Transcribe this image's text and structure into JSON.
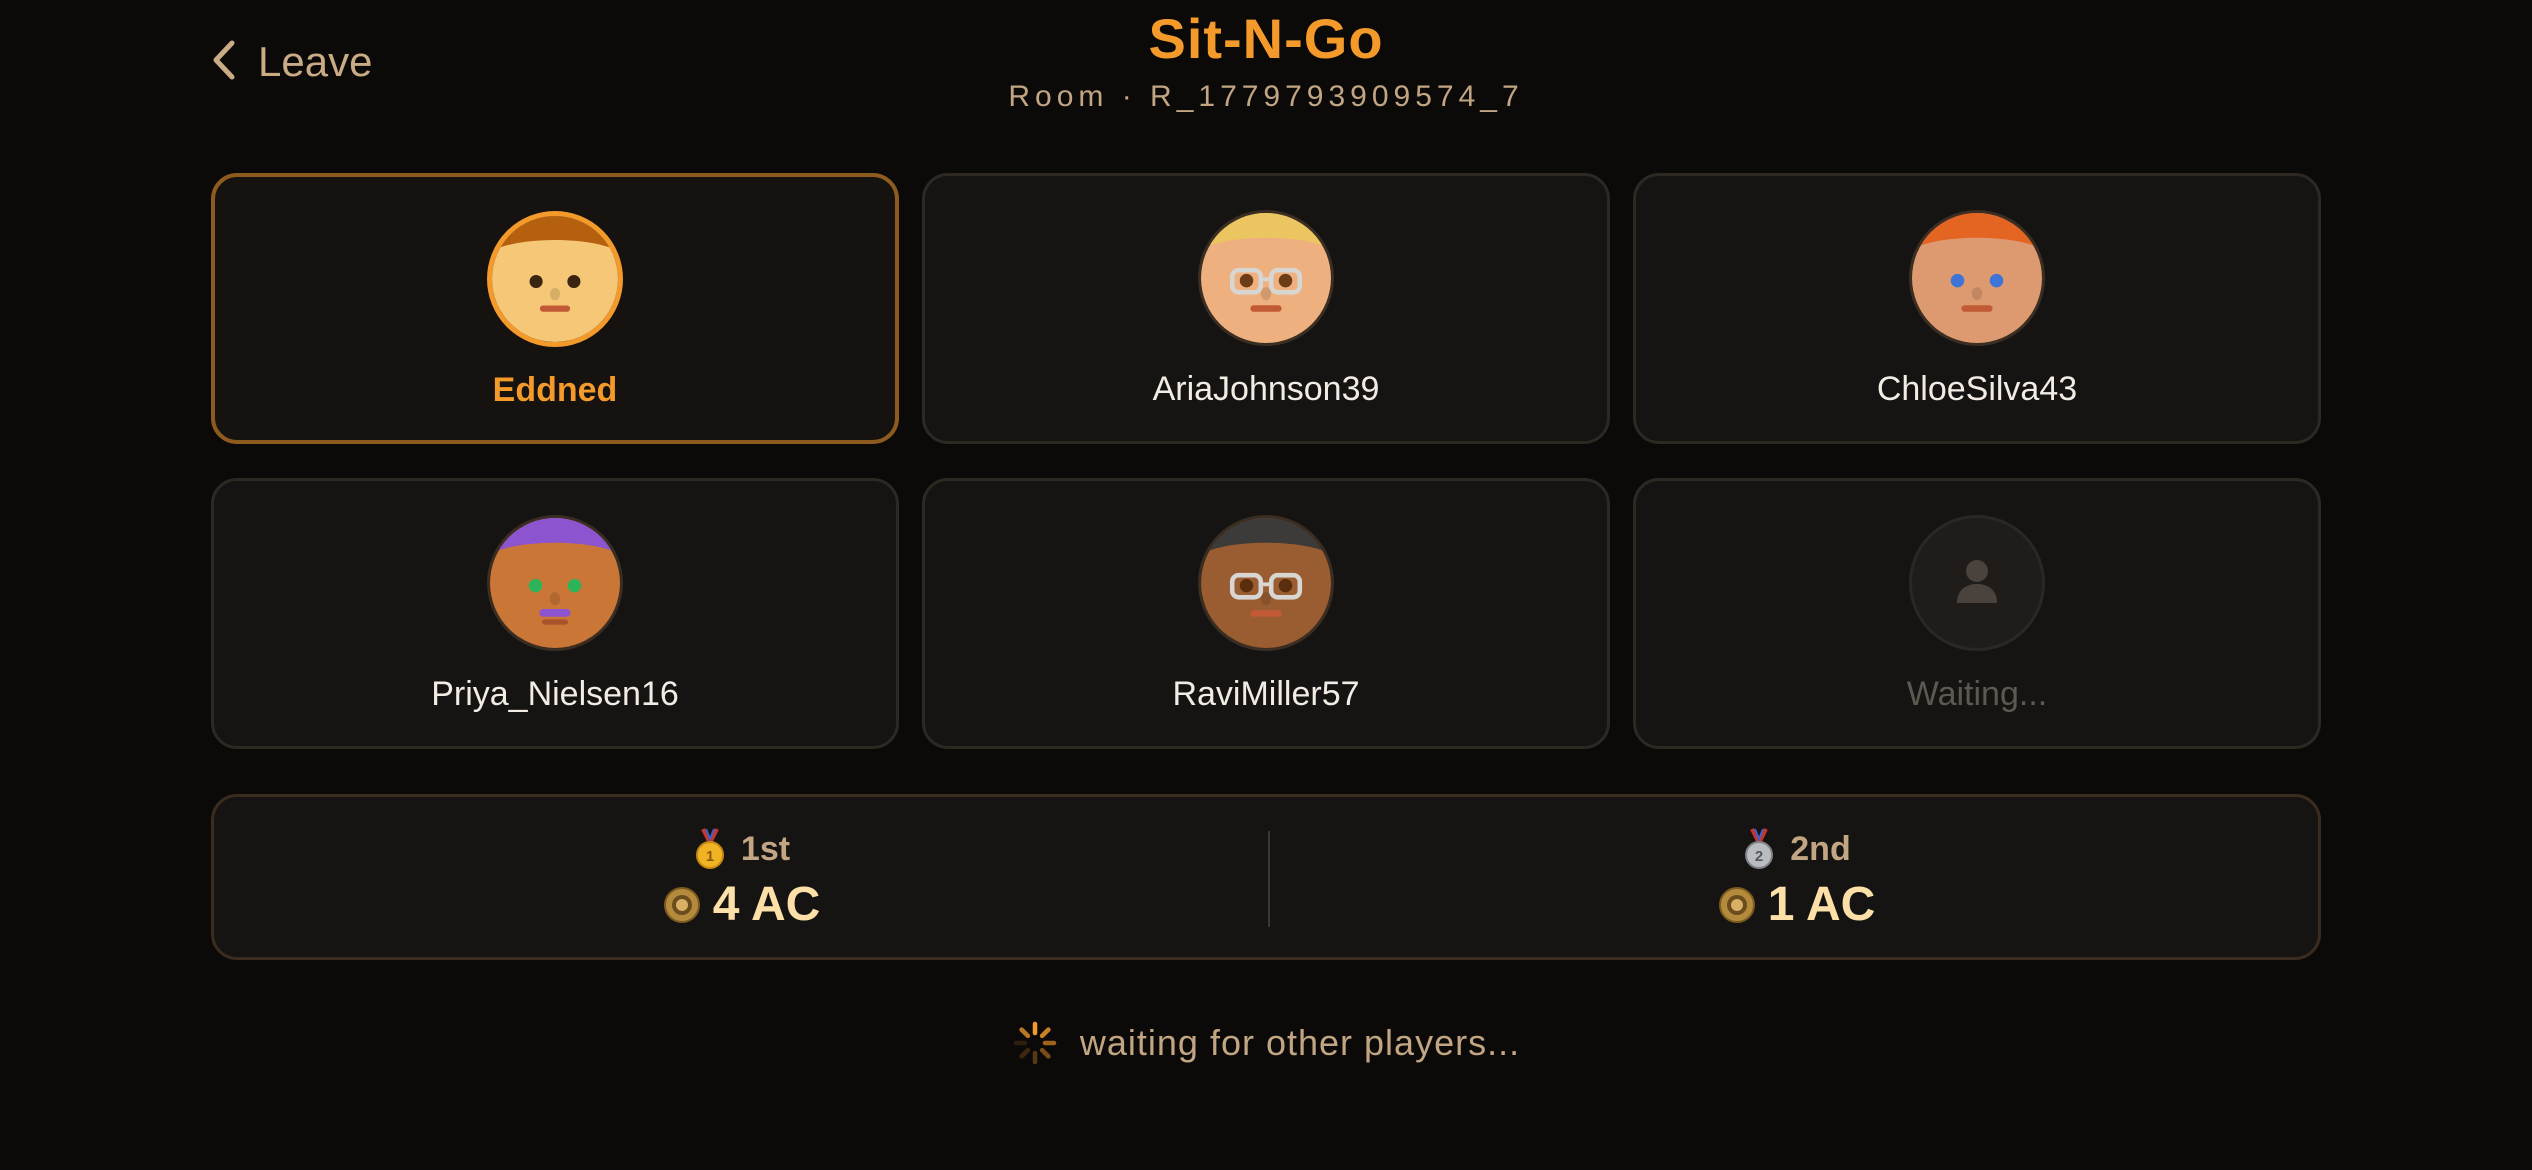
{
  "header": {
    "leave_label": "Leave",
    "title": "Sit-N-Go",
    "room_id": "Room · R_1779793909574_7"
  },
  "seats": [
    {
      "name": "Eddned",
      "is_self": true,
      "hair": "#b4600f",
      "skin": "#f5c777",
      "eyes": "#3b2410",
      "glasses": false
    },
    {
      "name": "AriaJohnson39",
      "is_self": false,
      "hair": "#ebc660",
      "skin": "#eeb07e",
      "eyes": "#6b3c16",
      "glasses": true
    },
    {
      "name": "ChloeSilva43",
      "is_self": false,
      "hair": "#e46421",
      "skin": "#dd9a70",
      "eyes": "#3d74d6",
      "glasses": false
    },
    {
      "name": "Priya_Nielsen16",
      "is_self": false,
      "hair": "#8c55cf",
      "skin": "#c97637",
      "eyes": "#2fb35a",
      "glasses": false
    },
    {
      "name": "RaviMiller57",
      "is_self": false,
      "hair": "#3d3b3a",
      "skin": "#9a5d31",
      "eyes": "#5a2d0d",
      "glasses": true
    },
    {
      "name": "Waiting...",
      "is_self": false,
      "empty": true
    }
  ],
  "prizes": [
    {
      "place": "1st",
      "amount": "4 AC",
      "medal": "gold-medal-icon"
    },
    {
      "place": "2nd",
      "amount": "1 AC",
      "medal": "silver-medal-icon"
    }
  ],
  "status": {
    "text": "waiting for other players..."
  },
  "colors": {
    "accent": "#f39a2b",
    "background": "#0b0a09",
    "card": "#161412",
    "muted_text": "#c2a583",
    "prize_text": "#fde0a8"
  }
}
